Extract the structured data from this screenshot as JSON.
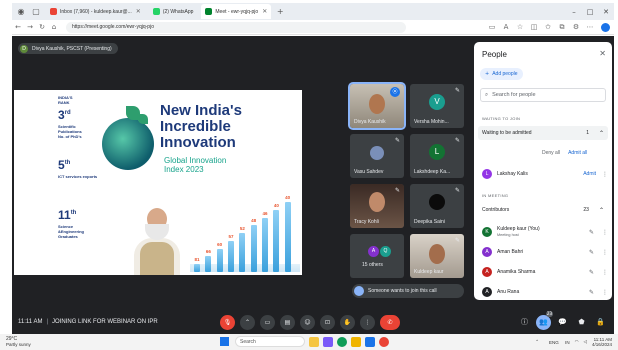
{
  "browser": {
    "tabs": [
      {
        "label": "Inbox (7,960) - kuldeep.kaur@..."
      },
      {
        "label": "(2) WhatsApp"
      },
      {
        "label": "Meet - ewr-yqjq-pjo",
        "active": true
      }
    ],
    "new_tab": "+",
    "url": "https://meet.google.com/ewr-yqjq-pjo",
    "window_controls": [
      "–",
      "□",
      "✕"
    ]
  },
  "meet": {
    "presenter": {
      "initial": "D",
      "label": "Divya Kaushik, PSCST (Presenting)"
    },
    "slide": {
      "rank_header": [
        "INDIA'S",
        "RANK"
      ],
      "stats": [
        {
          "rank": "3",
          "suffix": "rd",
          "desc": [
            "Scientific",
            "Publications",
            "No. of PhD's"
          ]
        },
        {
          "rank": "5",
          "suffix": "th",
          "desc": [
            "ICT services exports"
          ]
        },
        {
          "rank": "11",
          "suffix": "th",
          "desc": [
            "Science",
            "&Engineering",
            "Graduates"
          ]
        }
      ],
      "title": [
        "New India's",
        "Incredible",
        "Innovation"
      ],
      "subtitle": [
        "Global Innovation",
        "Index 2023"
      ],
      "chart_data": {
        "type": "bar",
        "values": [
          81,
          66,
          60,
          57,
          52,
          48,
          46,
          40,
          40
        ]
      }
    },
    "tiles": [
      {
        "name": "Divya Kaushik",
        "speaking": true,
        "badge": "⦿"
      },
      {
        "name": "Versha Mohin...",
        "initial": "V",
        "color": "#1a9e8f"
      },
      {
        "name": "Vasu Sahdev"
      },
      {
        "name": "Lakshdeep Ka...",
        "initial": "L",
        "color": "#137333"
      },
      {
        "name": "Tracy Kohli"
      },
      {
        "name": "Deepika Saini"
      },
      {
        "name": "15 others",
        "initials": [
          "A",
          "Q"
        ]
      },
      {
        "name": "Kuldeep kaur"
      }
    ],
    "toast": "Someone wants to join this call",
    "bottom": {
      "time": "11:11 AM",
      "separator": "|",
      "title": "JOINING LINK FOR WEBINAR ON IPR"
    },
    "controls": {
      "mic": "🎙",
      "more": "⌃",
      "camera": "▭",
      "captions": "▤",
      "emoji": "☺",
      "present": "⊡",
      "hand": "✋",
      "options": "⋮",
      "end": "✆"
    },
    "right_controls": {
      "info": "ⓘ",
      "people": "👥",
      "people_count": "23",
      "chat": "💬",
      "activities": "⬟",
      "host": "🔒"
    }
  },
  "people_panel": {
    "title": "People",
    "close": "✕",
    "add_people": "Add people",
    "search_placeholder": "Search for people",
    "waiting_section": "WAITING TO JOIN",
    "waiting_group": {
      "label": "Waiting to be admitted",
      "count": "1"
    },
    "deny_all": "Deny all",
    "admit_all": "Admit all",
    "waiting_person": {
      "initial": "L",
      "name": "Lakshay Kalis",
      "action": "Admit",
      "color": "#9334e6"
    },
    "in_meeting_section": "IN MEETING",
    "contributors": {
      "label": "Contributors",
      "count": "23"
    },
    "members": [
      {
        "initial": "K",
        "name": "Kuldeep kaur (You)",
        "sub": "Meeting host",
        "color": "#137333"
      },
      {
        "initial": "A",
        "name": "Aman Bahri",
        "color": "#8430ce"
      },
      {
        "initial": "A",
        "name": "Anamika Sharma",
        "color": "#c5221f"
      },
      {
        "initial": "A",
        "name": "Anu Rana",
        "color": "#202124"
      }
    ]
  },
  "taskbar": {
    "weather_temp": "29°C",
    "weather_desc": "Partly sunny",
    "search_label": "Search",
    "lang": "ENG",
    "lang2": "IN",
    "time": "11:11 AM",
    "date": "4/16/2024"
  }
}
